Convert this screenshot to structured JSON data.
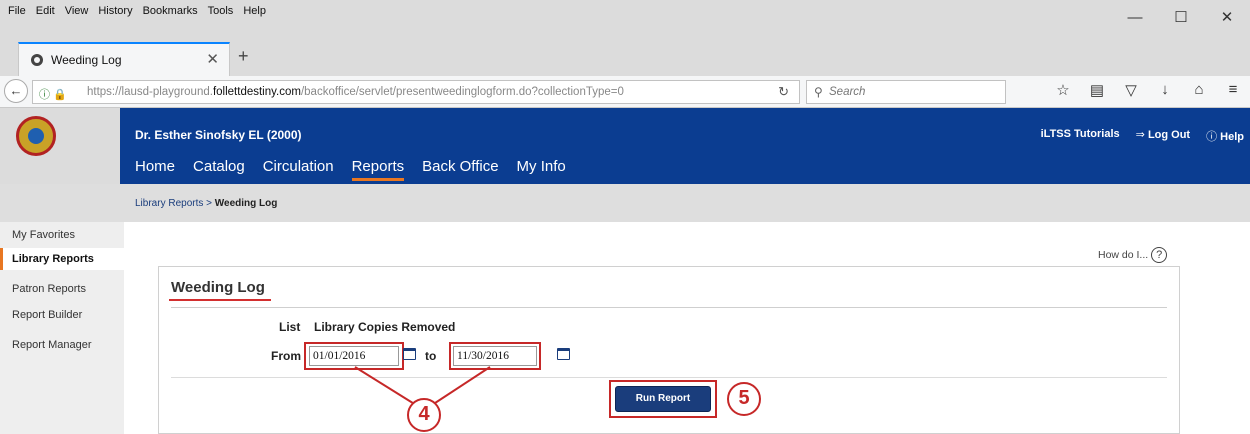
{
  "browser": {
    "menu": [
      "File",
      "Edit",
      "View",
      "History",
      "Bookmarks",
      "Tools",
      "Help"
    ],
    "window_controls": {
      "minimize": "—",
      "maximize": "☐",
      "close": "✕"
    },
    "tab": {
      "title": "Weeding Log",
      "close": "✕"
    },
    "new_tab": "+",
    "url": {
      "prefix": "https://lausd-playground.",
      "domain": "follettdestiny.com",
      "path": "/backoffice/servlet/presentweedinglogform.do?collectionType=0"
    },
    "search_placeholder": "Search",
    "icons": [
      "star-icon",
      "clipboard-icon",
      "pocket-icon",
      "download-icon",
      "home-icon",
      "menu-icon"
    ]
  },
  "header": {
    "school": "Dr. Esther Sinofsky EL (2000)",
    "nav": [
      "Home",
      "Catalog",
      "Circulation",
      "Reports",
      "Back Office",
      "My Info"
    ],
    "active_nav": "Reports",
    "tutorials": "iLTSS Tutorials",
    "logout": "Log Out",
    "help": "Help"
  },
  "breadcrumb": {
    "parent": "Library Reports",
    "separator": " > ",
    "current": "Weeding Log"
  },
  "sidebar": {
    "items": [
      "My Favorites",
      "Library Reports",
      "Patron Reports",
      "Report Builder",
      "Report Manager"
    ],
    "active": "Library Reports"
  },
  "content": {
    "howdo": "How do I...",
    "title": "Weeding Log",
    "list_label": "List",
    "list_value": "Library Copies Removed",
    "from_label": "From",
    "to_label": "to",
    "from_date": "01/01/2016",
    "to_date": "11/30/2016",
    "run_button": "Run Report"
  },
  "annotations": {
    "step_inputs": "4",
    "step_button": "5",
    "color": "#c62828"
  }
}
